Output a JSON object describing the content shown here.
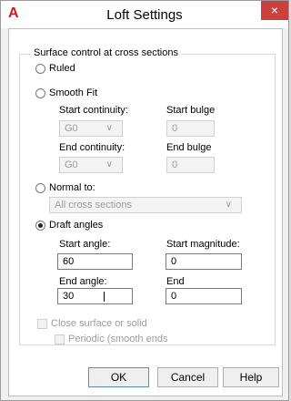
{
  "window": {
    "title": "Loft Settings",
    "app_icon": "A",
    "close_glyph": "×"
  },
  "section": {
    "title": "Surface control at cross sections"
  },
  "options": {
    "ruled": "Ruled",
    "smooth_fit": "Smooth Fit",
    "normal_to": "Normal to:",
    "draft_angles": "Draft angles"
  },
  "smooth_fit": {
    "start_continuity_label": "Start continuity:",
    "start_continuity_value": "G0",
    "start_bulge_label": "Start bulge",
    "start_bulge_value": "0",
    "end_continuity_label": "End continuity:",
    "end_continuity_value": "G0",
    "end_bulge_label": "End bulge",
    "end_bulge_value": "0"
  },
  "normal_to": {
    "value": "All cross sections"
  },
  "draft_angles": {
    "start_angle_label": "Start angle:",
    "start_angle_value": "60",
    "start_magnitude_label": "Start magnitude:",
    "start_magnitude_value": "0",
    "end_angle_label": "End angle:",
    "end_angle_value": "30",
    "end_label": "End",
    "end_value": "0"
  },
  "checkboxes": {
    "close_surface": "Close surface or solid",
    "periodic": "Periodic (smooth ends"
  },
  "buttons": {
    "ok": "OK",
    "cancel": "Cancel",
    "help": "Help"
  },
  "selected_option": "draft_angles",
  "colors": {
    "title_close_bg": "#c9403c",
    "app_icon": "#d11a1a",
    "default_button_border": "#5e89c8"
  }
}
